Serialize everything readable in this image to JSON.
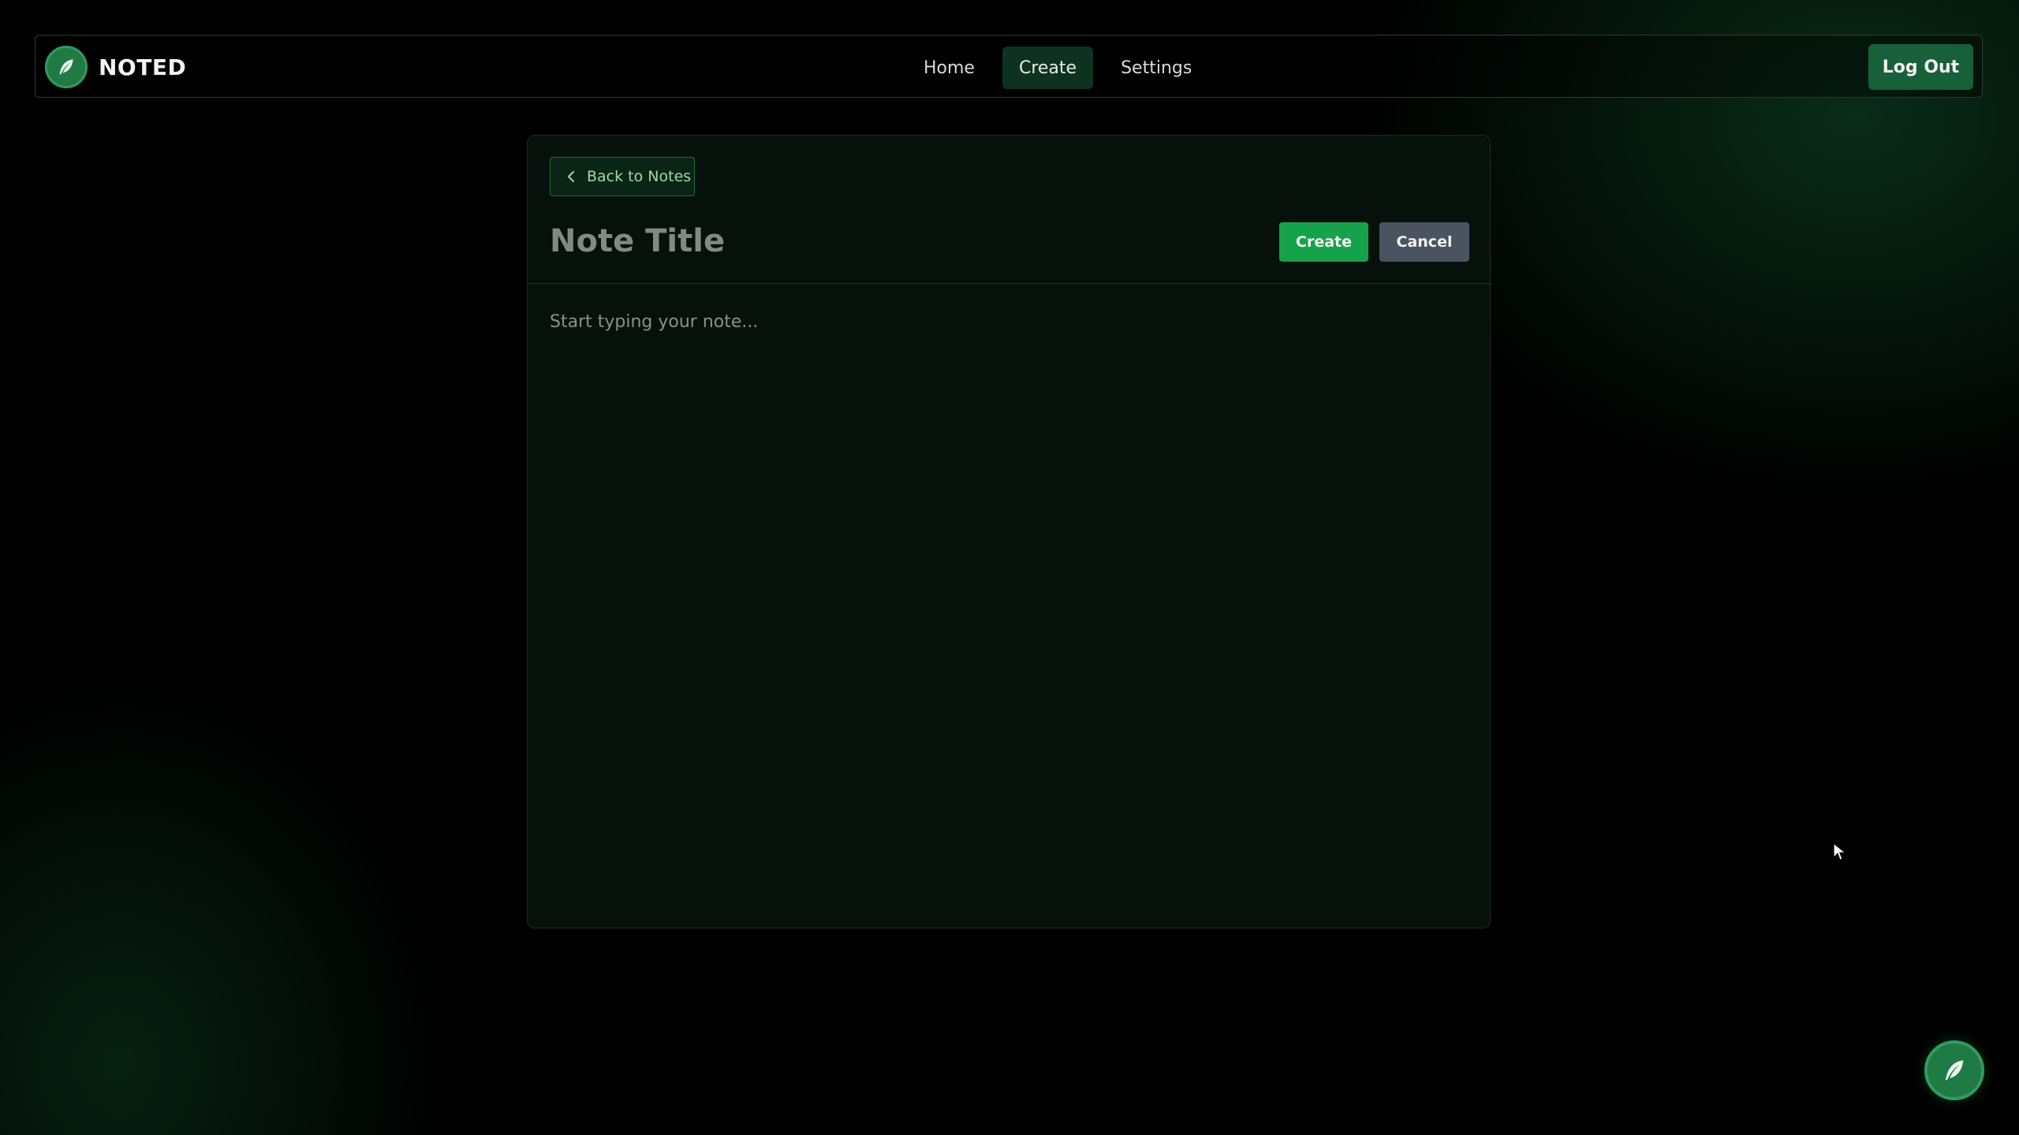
{
  "app": {
    "brand": "NOTED",
    "logo_icon": "feather-icon"
  },
  "nav": {
    "items": [
      {
        "label": "Home",
        "active": false
      },
      {
        "label": "Create",
        "active": true
      },
      {
        "label": "Settings",
        "active": false
      }
    ],
    "logout_label": "Log Out"
  },
  "editor": {
    "back_label": "Back to Notes",
    "title_placeholder": "Note Title",
    "title_value": "",
    "create_label": "Create",
    "cancel_label": "Cancel",
    "body_placeholder": "Start typing your note...",
    "body_value": ""
  },
  "colors": {
    "accent": "#16a24a",
    "brand_green": "#1f7a45",
    "cancel_gray": "#4a5360"
  }
}
